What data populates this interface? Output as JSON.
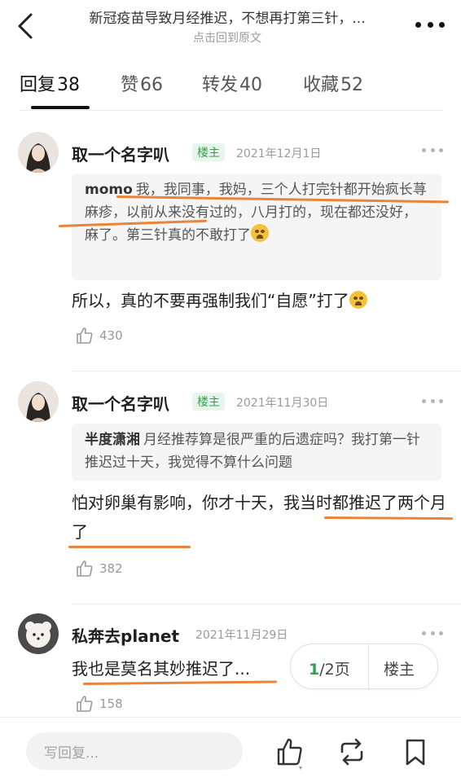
{
  "header": {
    "title": "新冠疫苗导致月经推迟，不想再打第三针，...",
    "subtitle": "点击回到原文"
  },
  "tabs": [
    {
      "label": "回复",
      "count": "38"
    },
    {
      "label": "赞",
      "count": "66"
    },
    {
      "label": "转发",
      "count": "40"
    },
    {
      "label": "收藏",
      "count": "52"
    }
  ],
  "posts": [
    {
      "author": "取一个名字叭",
      "badge": "楼主",
      "date": "2021年12月1日",
      "quote_name": "momo",
      "quote_text": "我，我同事，我妈，三个人打完针都开始疯长荨麻疹，以前从来没有过的，八月打的，现在都还没好，麻了。第三针真的不敢打了",
      "text": "所以，真的不要再强制我们“自愿”打了",
      "likes": "430"
    },
    {
      "author": "取一个名字叭",
      "badge": "楼主",
      "date": "2021年11月30日",
      "quote_name": "半度潇湘",
      "quote_text": "月经推荐算是很严重的后遗症吗？我打第一针推迟过十天，我觉得不算什么问题",
      "text": "怕对卵巢有影响，你才十天，我当时都推迟了两个月了",
      "likes": "382"
    },
    {
      "author": "私奔去planet",
      "date": "2021年11月29日",
      "text": "我也是莫名其妙推迟了...",
      "likes": "158"
    }
  ],
  "pager": {
    "current": "1",
    "total": "/2页",
    "op_label": "楼主"
  },
  "bottom": {
    "reply_placeholder": "写回复..."
  },
  "colors": {
    "accent": "#2fa24a",
    "highlight": "#e8853b"
  }
}
